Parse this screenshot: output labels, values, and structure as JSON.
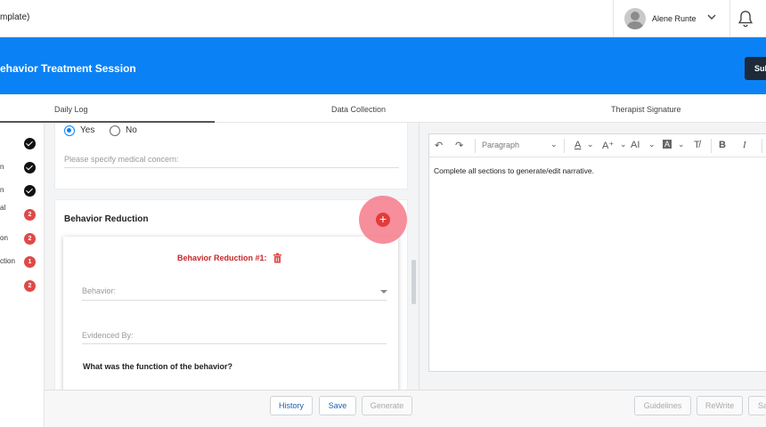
{
  "topbar": {
    "doc_title": "mplate)",
    "user_name": "Alene Runte"
  },
  "banner": {
    "title": "ehavior Treatment Session",
    "submit_label": "Sub"
  },
  "tabs": [
    {
      "label": "Daily Log"
    },
    {
      "label": "Data Collection"
    },
    {
      "label": "Therapist Signature"
    }
  ],
  "sidebar": {
    "items": [
      {
        "label": "",
        "status": "done"
      },
      {
        "label": "n",
        "status": "done"
      },
      {
        "label": "n",
        "status": "done"
      },
      {
        "label": "al",
        "count": "2"
      },
      {
        "label": "on",
        "count": "2"
      },
      {
        "label": "ction",
        "count": "1"
      },
      {
        "label": "",
        "count": "2"
      }
    ]
  },
  "medical": {
    "yes_label": "Yes",
    "no_label": "No",
    "selected": "Yes",
    "concern_placeholder": "Please specify medical concern:"
  },
  "behavior_reduction": {
    "section_title": "Behavior Reduction",
    "add_symbol": "+",
    "item_title": "Behavior Reduction #1:",
    "behavior_label": "Behavior:",
    "evidenced_label": "Evidenced By:",
    "function_question": "What was the function of the behavior?"
  },
  "form_actions": {
    "history": "History",
    "save": "Save",
    "generate": "Generate"
  },
  "editor": {
    "paragraph_style": "Paragraph",
    "content": "Complete all sections to generate/edit narrative."
  },
  "narrative_actions": {
    "guidelines": "Guidelines",
    "rewrite": "ReWrite",
    "save": "Sa"
  },
  "colors": {
    "primary": "#0a82f5",
    "danger": "#e04848",
    "title_red": "#c62828"
  }
}
